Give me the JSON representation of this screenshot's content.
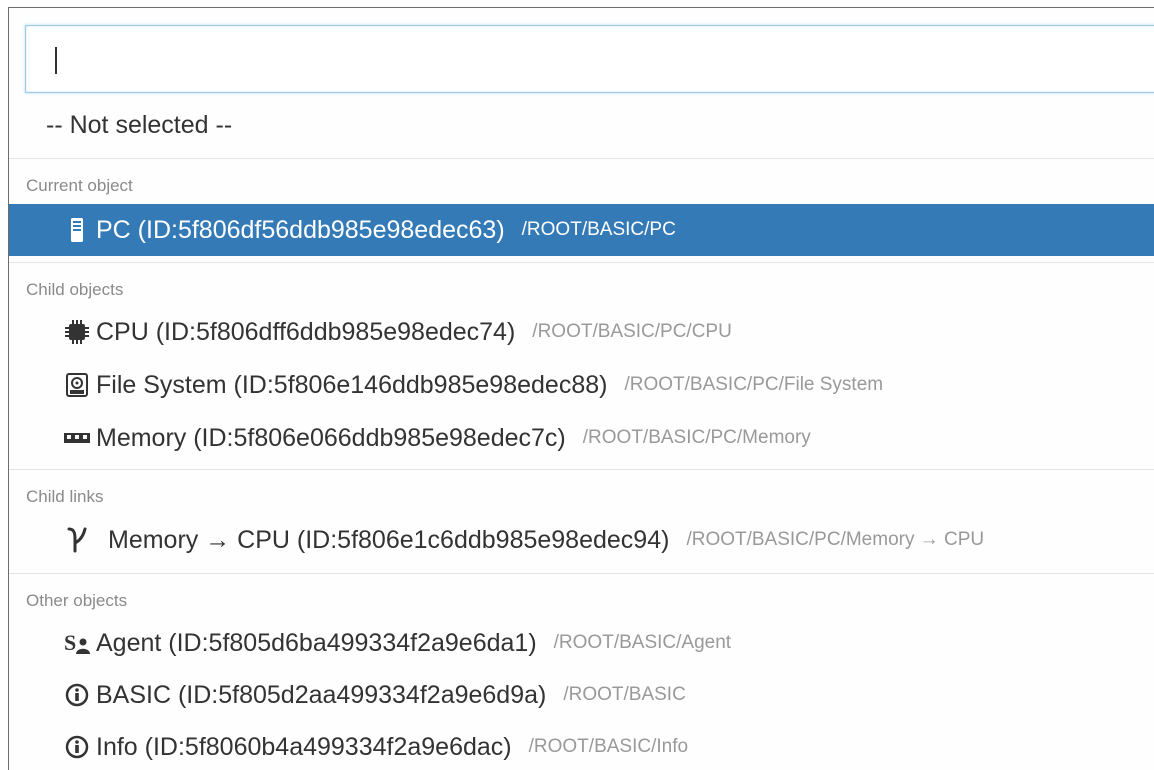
{
  "search": {
    "value": "",
    "placeholder": ""
  },
  "not_selected_label": "-- Not selected --",
  "groups": [
    {
      "header": "Current object",
      "items": [
        {
          "icon": "server-icon",
          "name": "PC (ID:5f806df56ddb985e98edec63)",
          "path": "/ROOT/BASIC/PC",
          "selected": true
        }
      ]
    },
    {
      "header": "Child objects",
      "items": [
        {
          "icon": "chip-icon",
          "name": "CPU (ID:5f806dff6ddb985e98edec74)",
          "path": "/ROOT/BASIC/PC/CPU"
        },
        {
          "icon": "hard-disk-icon",
          "name": "File System (ID:5f806e146ddb985e98edec88)",
          "path": "/ROOT/BASIC/PC/File System"
        },
        {
          "icon": "memory-icon",
          "name": "Memory (ID:5f806e066ddb985e98edec7c)",
          "path": "/ROOT/BASIC/PC/Memory"
        }
      ]
    },
    {
      "header": "Child links",
      "items": [
        {
          "icon": "link-icon",
          "name": "Memory → CPU (ID:5f806e1c6ddb985e98edec94)",
          "path": "/ROOT/BASIC/PC/Memory → CPU"
        }
      ]
    },
    {
      "header": "Other objects",
      "items": [
        {
          "icon": "agent-icon",
          "name": "Agent (ID:5f805d6ba499334f2a9e6da1)",
          "path": "/ROOT/BASIC/Agent"
        },
        {
          "icon": "info-icon",
          "name": "BASIC (ID:5f805d2aa499334f2a9e6d9a)",
          "path": "/ROOT/BASIC"
        },
        {
          "icon": "info-icon",
          "name": "Info (ID:5f8060b4a499334f2a9e6dac)",
          "path": "/ROOT/BASIC/Info"
        }
      ]
    }
  ],
  "colors": {
    "selected_background": "#337ab7",
    "header_text": "#8a8a8a",
    "path_text": "#999999",
    "item_text": "#333333"
  }
}
